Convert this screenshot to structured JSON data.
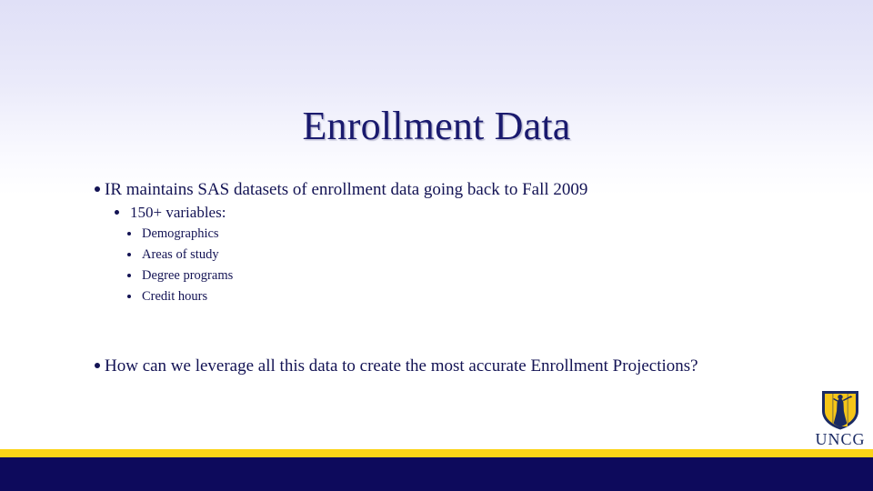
{
  "slide": {
    "title": "Enrollment Data",
    "bullets": [
      {
        "level": 1,
        "text": "IR maintains SAS datasets of enrollment data going back to Fall 2009"
      },
      {
        "level": 2,
        "text": "150+ variables:"
      },
      {
        "level": 3,
        "text": "Demographics"
      },
      {
        "level": 3,
        "text": "Areas of study"
      },
      {
        "level": 3,
        "text": "Degree programs"
      },
      {
        "level": 3,
        "text": "Credit hours"
      }
    ],
    "question": "How can we leverage all this data to create the most accurate Enrollment Projections?"
  },
  "logo": {
    "wordmark": "UNCG",
    "shield_icon": "uncg-shield-icon",
    "gold": "#fbd417",
    "navy": "#1a2a63"
  },
  "theme": {
    "title_color": "#1a1a6e",
    "text_color": "#131354",
    "accent_gold": "#fbd417",
    "footer_navy": "#0d0a5c",
    "background_top": "#e0e0f7",
    "background_bottom": "#ffffff"
  }
}
